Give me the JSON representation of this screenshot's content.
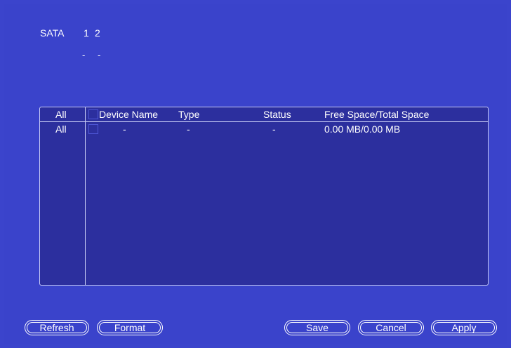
{
  "sata": {
    "label": "SATA",
    "ports": [
      "1",
      "2"
    ],
    "port_status": [
      "-",
      "-"
    ]
  },
  "table": {
    "headers": {
      "all": "All",
      "device_name": "Device Name",
      "type": "Type",
      "status": "Status",
      "space": "Free Space/Total Space"
    },
    "rows": [
      {
        "all": "All",
        "device_name": "-",
        "type": "-",
        "status": "-",
        "space": "0.00 MB/0.00 MB"
      }
    ]
  },
  "buttons": {
    "refresh": "Refresh",
    "format": "Format",
    "save": "Save",
    "cancel": "Cancel",
    "apply": "Apply"
  },
  "colors": {
    "background": "#3b44cc",
    "table_background": "#2c2f9e",
    "text": "#ffffff"
  }
}
